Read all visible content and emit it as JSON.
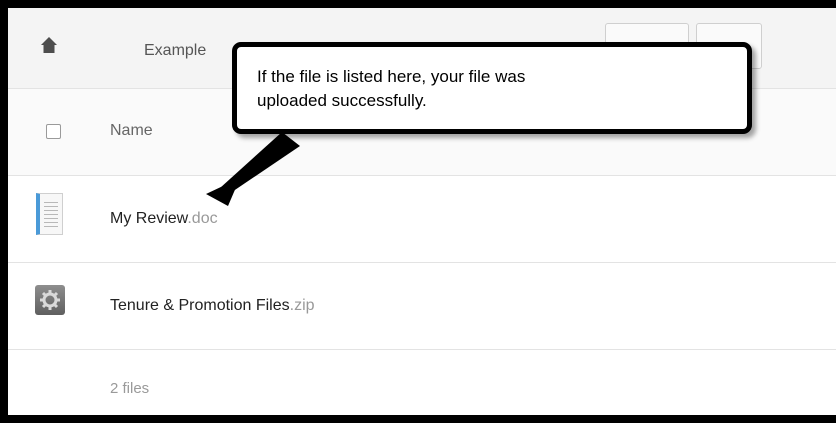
{
  "topbar": {
    "home_icon": "home-icon",
    "breadcrumb": "Example"
  },
  "file_list": {
    "header": {
      "name_label": "Name"
    },
    "files": [
      {
        "name": "My Review",
        "ext": ".doc",
        "icon": "document-icon"
      },
      {
        "name": "Tenure & Promotion Files",
        "ext": ".zip",
        "icon": "archive-gear-icon"
      }
    ],
    "count": "2 files"
  },
  "callout": {
    "text": "If the file is listed here, your file was\nuploaded successfully."
  }
}
